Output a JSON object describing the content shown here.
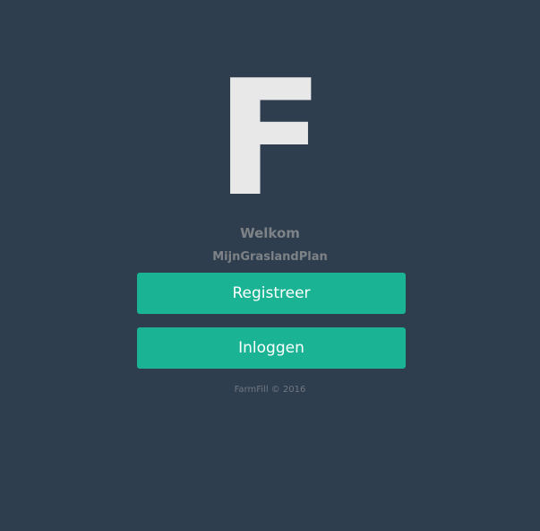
{
  "logo": {
    "letter": "F"
  },
  "welcome": {
    "title": "Welkom",
    "app_name": "MijnGraslandPlan"
  },
  "actions": {
    "register_label": "Registreer",
    "login_label": "Inloggen"
  },
  "footer": {
    "copyright": "FarmFill © 2016"
  },
  "colors": {
    "background": "#2f3e4f",
    "accent": "#1ab394",
    "logo": "#e8e8e8",
    "muted_text": "#7d8287"
  }
}
